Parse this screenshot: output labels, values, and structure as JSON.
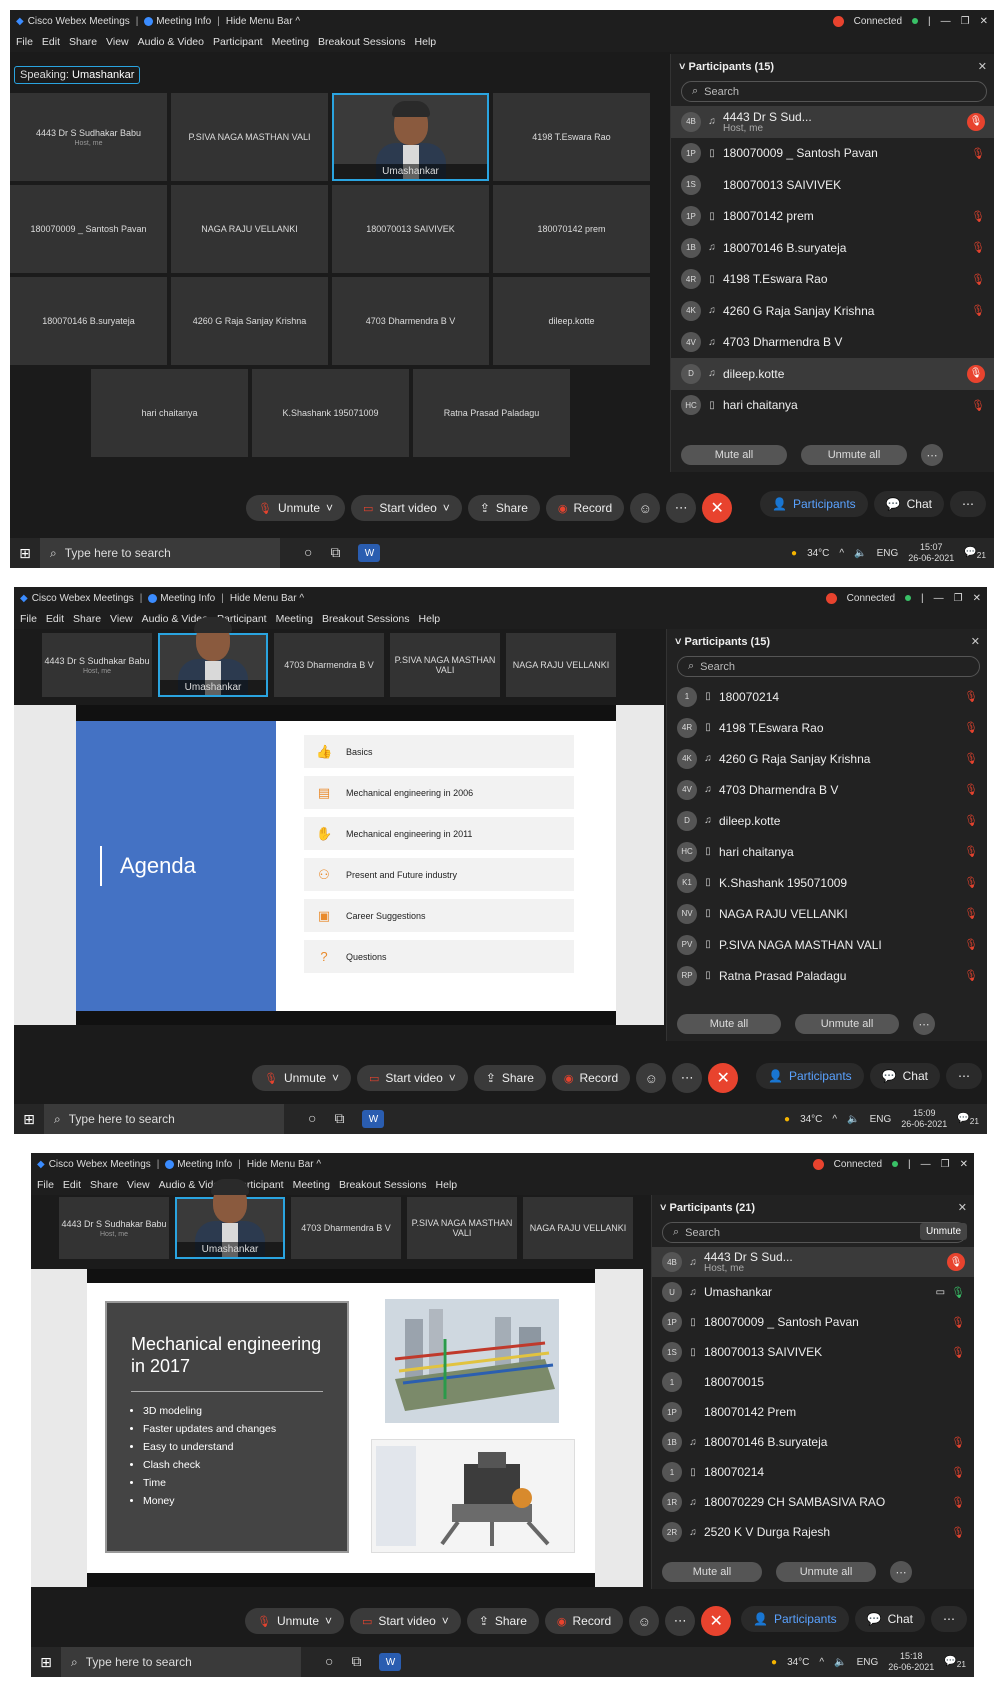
{
  "app": {
    "name": "Cisco Webex Meetings",
    "meeting_info": "Meeting Info",
    "hide_menu": "Hide Menu Bar ^",
    "connected": "Connected",
    "menus": [
      "File",
      "Edit",
      "Share",
      "View",
      "Audio & Video",
      "Participant",
      "Meeting",
      "Breakout Sessions",
      "Help"
    ]
  },
  "controls": {
    "unmute": "Unmute",
    "start_video": "Start video",
    "share": "Share",
    "record": "Record",
    "participants": "Participants",
    "chat": "Chat",
    "mute_all": "Mute all",
    "unmute_all": "Unmute all",
    "search": "Search"
  },
  "taskbar": {
    "search_placeholder": "Type here to search",
    "temp": "34°C",
    "lang": "ENG",
    "date": "26-06-2021",
    "notif": "21"
  },
  "shot1": {
    "speaking_label": "Speaking:",
    "speaking_name": "Umashankar",
    "tiles": [
      {
        "name": "4443 Dr S Sudhakar Babu",
        "sub": "Host, me"
      },
      {
        "name": "P.SIVA NAGA MASTHAN VALI",
        "sub": ""
      },
      {
        "name": "Umashankar",
        "sub": "",
        "video": true
      },
      {
        "name": "4198 T.Eswara Rao",
        "sub": ""
      },
      {
        "name": "180070009 _ Santosh Pavan",
        "sub": ""
      },
      {
        "name": "NAGA RAJU VELLANKI",
        "sub": ""
      },
      {
        "name": "180070013 SAIVIVEK",
        "sub": ""
      },
      {
        "name": "180070142 prem",
        "sub": ""
      },
      {
        "name": "180070146 B.suryateja",
        "sub": ""
      },
      {
        "name": "4260 G Raja Sanjay Krishna",
        "sub": ""
      },
      {
        "name": "4703 Dharmendra B V",
        "sub": ""
      },
      {
        "name": "dileep.kotte",
        "sub": ""
      },
      {
        "name": "hari chaitanya",
        "sub": ""
      },
      {
        "name": "K.Shashank 195071009",
        "sub": ""
      },
      {
        "name": "Ratna Prasad Paladagu",
        "sub": ""
      }
    ],
    "panel_title": "Participants (15)",
    "participants": [
      {
        "av": "4B",
        "dev": "headset",
        "name": "4443 Dr S Sud...",
        "sub": "Host, me",
        "hl": true,
        "mic": "red-round"
      },
      {
        "av": "1P",
        "dev": "phone",
        "name": "180070009 _ Santosh Pavan",
        "mic": "red"
      },
      {
        "av": "1S",
        "dev": "",
        "name": "180070013 SAIVIVEK",
        "mic": ""
      },
      {
        "av": "1P",
        "dev": "phone",
        "name": "180070142 prem",
        "mic": "red"
      },
      {
        "av": "1B",
        "dev": "headset",
        "name": "180070146 B.suryateja",
        "mic": "red"
      },
      {
        "av": "4R",
        "dev": "phone",
        "name": "4198 T.Eswara Rao",
        "mic": "red"
      },
      {
        "av": "4K",
        "dev": "headset",
        "name": "4260 G Raja Sanjay Krishna",
        "mic": "red"
      },
      {
        "av": "4V",
        "dev": "headset",
        "name": "4703 Dharmendra B V",
        "mic": ""
      },
      {
        "av": "D",
        "dev": "headset",
        "name": "dileep.kotte",
        "mic": "red-round",
        "hl": true
      },
      {
        "av": "HC",
        "dev": "phone",
        "name": "hari chaitanya",
        "mic": "red"
      }
    ],
    "time": "15:07"
  },
  "shot2": {
    "tiles": [
      {
        "name": "4443 Dr S Sudhakar Babu",
        "sub": "Host, me"
      },
      {
        "name": "Umashankar",
        "sub": "",
        "video": true
      },
      {
        "name": "4703 Dharmendra B V",
        "sub": ""
      },
      {
        "name": "P.SIVA NAGA MASTHAN VALI",
        "sub": ""
      },
      {
        "name": "NAGA RAJU VELLANKI",
        "sub": ""
      }
    ],
    "slide": {
      "title": "Agenda",
      "items": [
        {
          "icon": "👍",
          "label": "Basics"
        },
        {
          "icon": "▤",
          "label": "Mechanical engineering in 2006"
        },
        {
          "icon": "✋",
          "label": "Mechanical engineering in 2011"
        },
        {
          "icon": "⚇",
          "label": "Present and Future industry"
        },
        {
          "icon": "▣",
          "label": "Career Suggestions"
        },
        {
          "icon": "?",
          "label": "Questions"
        }
      ]
    },
    "panel_title": "Participants (15)",
    "participants": [
      {
        "av": "1",
        "dev": "phone",
        "name": "180070214",
        "mic": "red"
      },
      {
        "av": "4R",
        "dev": "phone",
        "name": "4198 T.Eswara Rao",
        "mic": "red"
      },
      {
        "av": "4K",
        "dev": "headset",
        "name": "4260 G Raja Sanjay Krishna",
        "mic": "red"
      },
      {
        "av": "4V",
        "dev": "headset",
        "name": "4703 Dharmendra B V",
        "mic": "red"
      },
      {
        "av": "D",
        "dev": "headset",
        "name": "dileep.kotte",
        "mic": "red"
      },
      {
        "av": "HC",
        "dev": "phone",
        "name": "hari chaitanya",
        "mic": "red"
      },
      {
        "av": "K1",
        "dev": "phone",
        "name": "K.Shashank 195071009",
        "mic": "red"
      },
      {
        "av": "NV",
        "dev": "phone",
        "name": "NAGA RAJU VELLANKI",
        "mic": "red"
      },
      {
        "av": "PV",
        "dev": "phone",
        "name": "P.SIVA NAGA MASTHAN VALI",
        "mic": "red"
      },
      {
        "av": "RP",
        "dev": "phone",
        "name": "Ratna Prasad Paladagu",
        "mic": "red"
      }
    ],
    "time": "15:09"
  },
  "shot3": {
    "tiles": [
      {
        "name": "4443 Dr S Sudhakar Babu",
        "sub": "Host, me"
      },
      {
        "name": "Umashankar",
        "sub": "",
        "video": true
      },
      {
        "name": "4703 Dharmendra B V",
        "sub": ""
      },
      {
        "name": "P.SIVA NAGA MASTHAN VALI",
        "sub": ""
      },
      {
        "name": "NAGA RAJU VELLANKI",
        "sub": ""
      }
    ],
    "slide": {
      "title": "Mechanical engineering in 2017",
      "bullets": [
        "3D modeling",
        "Faster updates and changes",
        "Easy to understand",
        "Clash check",
        "Time",
        "Money"
      ]
    },
    "panel_title": "Participants (21)",
    "tooltip": "Unmute",
    "participants": [
      {
        "av": "4B",
        "dev": "headset",
        "name": "4443 Dr S Sud...",
        "sub": "Host, me",
        "hl": true,
        "mic": "red-round"
      },
      {
        "av": "U",
        "dev": "headset",
        "name": "Umashankar",
        "mic": "green"
      },
      {
        "av": "1P",
        "dev": "phone",
        "name": "180070009 _ Santosh Pavan",
        "mic": "red"
      },
      {
        "av": "1S",
        "dev": "phone",
        "name": "180070013 SAIVIVEK",
        "mic": "red"
      },
      {
        "av": "1",
        "dev": "",
        "name": "180070015",
        "mic": ""
      },
      {
        "av": "1P",
        "dev": "",
        "name": "180070142 Prem",
        "mic": ""
      },
      {
        "av": "1B",
        "dev": "headset",
        "name": "180070146 B.suryateja",
        "mic": "red"
      },
      {
        "av": "1",
        "dev": "phone",
        "name": "180070214",
        "mic": "red"
      },
      {
        "av": "1R",
        "dev": "headset",
        "name": "180070229 CH SAMBASIVA RAO",
        "mic": "red"
      },
      {
        "av": "2R",
        "dev": "headset",
        "name": "2520 K V Durga Rajesh",
        "mic": "red"
      }
    ],
    "time": "15:18"
  }
}
